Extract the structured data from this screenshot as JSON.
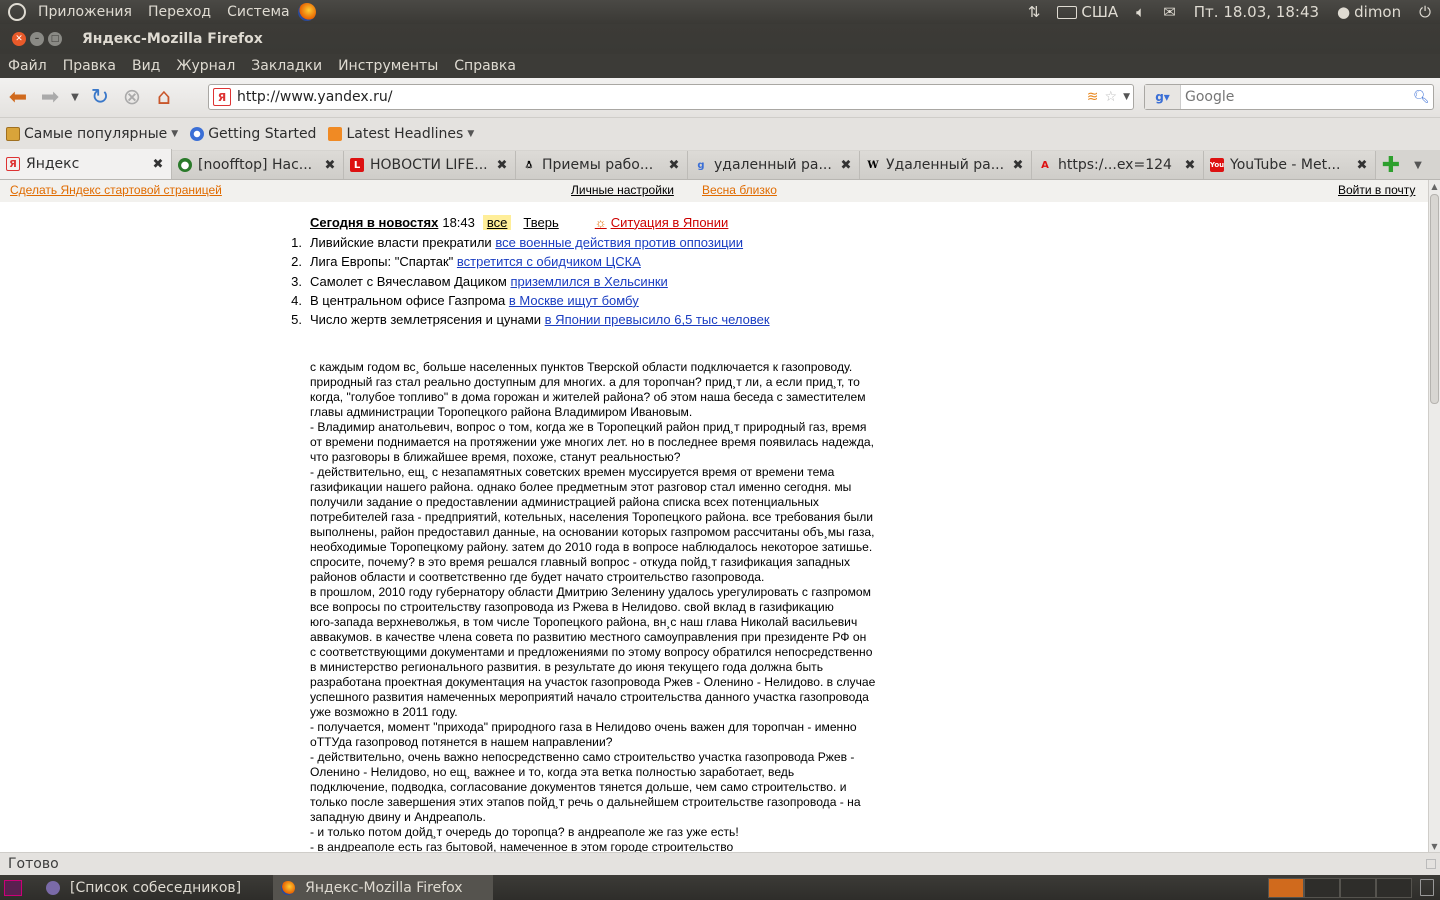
{
  "top_panel": {
    "menus": [
      "Приложения",
      "Переход",
      "Система"
    ],
    "keyboard_layout": "США",
    "datetime": "Пт. 18.03, 18:43",
    "user": "dimon"
  },
  "window": {
    "title": "Яндекс-Mozilla Firefox"
  },
  "menubar": {
    "items": [
      "Файл",
      "Правка",
      "Вид",
      "Журнал",
      "Закладки",
      "Инструменты",
      "Справка"
    ]
  },
  "navbar": {
    "url": "http://www.yandex.ru/",
    "search_placeholder": "Google"
  },
  "bookmarks": [
    {
      "label": "Самые популярные",
      "icon": "folder-icon",
      "dropdown": true
    },
    {
      "label": "Getting Started",
      "icon": "firefox-icon",
      "dropdown": false
    },
    {
      "label": "Latest Headlines",
      "icon": "rss-icon",
      "dropdown": true
    }
  ],
  "tabs": [
    {
      "label": "Яндекс",
      "icon": "yandex-icon",
      "active": true
    },
    {
      "label": "[noofftop] Нас...",
      "icon": "noofftop-icon",
      "active": false
    },
    {
      "label": "НОВОСТИ LIFE...",
      "icon": "life-icon",
      "active": false
    },
    {
      "label": "Приемы рабо...",
      "icon": "tux-icon",
      "active": false
    },
    {
      "label": "удаленный ра...",
      "icon": "google-icon",
      "active": false
    },
    {
      "label": "Удаленный ра...",
      "icon": "wikipedia-icon",
      "active": false
    },
    {
      "label": "https:/...ex=124",
      "icon": "acrobat-icon",
      "active": false
    },
    {
      "label": "YouTube - Met...",
      "icon": "youtube-icon",
      "active": false
    }
  ],
  "yandex_bar": {
    "make_start": "Сделать Яндекс стартовой страницей",
    "personal_settings": "Личные настройки",
    "spring": "Весна близко",
    "login_mail": "Войти в почту"
  },
  "news": {
    "heading": "Сегодня в новостях",
    "time": "18:43",
    "tab_all": "все",
    "tab_city": "Тверь",
    "special": "Ситуация в Японии",
    "items": [
      {
        "num": "1.",
        "text": "Ливийские власти прекратили ",
        "link": "все военные действия против оппозиции"
      },
      {
        "num": "2.",
        "text": "Лига Европы: \"Спартак\" ",
        "link": "встретится с обидчиком ЦСКА"
      },
      {
        "num": "3.",
        "text": "Самолет с Вячеславом Дациком ",
        "link": "приземлился в Хельсинки"
      },
      {
        "num": "4.",
        "text": "В центральном офисе Газпрома ",
        "link": "в Москве ищут бомбу"
      },
      {
        "num": "5.",
        "text": "Число жертв землетрясения и цунами ",
        "link": "в Японии превысило 6,5 тыс человек"
      }
    ]
  },
  "article": [
    "с каждым годом вс¸ больше населенных пунктов Тверской области подключается к газопроводу.",
    "природный газ стал реально доступным для многих. а для торопчан? прид¸т ли, а если прид¸т, то",
    "когда, \"голубое топливо\" в дома горожан и жителей района? об этом наша беседа с заместителем",
    "главы администрации Торопецкого района Владимиром Ивановым.",
    "- Владимир анатольевич, вопрос о том, когда же в Торопецкий район прид¸т природный газ, время",
    "от времени поднимается на протяжении уже многих лет. но в последнее время появилась надежда,",
    "что разговоры в ближайшее время, похоже, станут реальностью?",
    "- действительно, ещ¸ с незапамятных советских времен муссируется время от времени тема",
    "газификации нашего района. однако более предметным этот разговор стал именно сегодня. мы",
    "получили задание о предоставлении администрацией района списка всех потенциальных",
    "потребителей газа - предприятий, котельных, населения Торопецкого района. все требования были",
    "выполнены, район предоставил данные, на основании которых газпромом рассчитаны объ¸мы газа,",
    "необходимые Торопецкому району. затем до 2010 года в вопросе наблюдалось некоторое затишье.",
    "спросите, почему? в это время решался главный вопрос - откуда пойд¸т газификация западных",
    "районов области и соответственно где будет начато строительство газопровода.",
    "в прошлом, 2010 году губернатору области Дмитрию Зеленину удалось урегулировать с газпромом",
    "все вопросы по строительству газопровода из Ржева в Нелидово. свой вклад в газификацию",
    "юго-запада верхневолжья, в том числе Торопецкого района, вн¸с наш глава Николай васильевич",
    "аввакумов. в качестве члена совета по развитию местного самоуправления при президенте РФ он",
    "с соответствующими документами и предложениями по этому вопросу обратился непосредственно",
    "в министерство регионального развития. в результате до июня текущего года должна быть",
    "разработана проектная документация на участок газопровода Ржев - Оленино - Нелидово. в случае",
    "успешного развития намеченных мероприятий начало строительства данного участка газопровода",
    "уже возможно в 2011 году.",
    "- получается, момент \"прихода\" природного газа в Нелидово очень важен для торопчан - именно",
    "оТТУда газопровод потянется в нашем направлении?",
    "- действительно, очень важно непосредственно само строительство участка газопровода Ржев -",
    "Оленино - Нелидово, но ещ¸ важнее и то, когда эта ветка полностью заработает, ведь",
    "подключение, подводка, согласование документов тянется дольше, чем само строительство. и",
    "только после завершения этих этапов пойд¸т речь о дальнейшем строительстве газопровода - на",
    "западную двину и Андреаполь.",
    "- и только потом дойд¸т очередь до торопца? в андреаполе же газ уже есть!",
    "- в андреаполе есть газ бытовой, намеченное в этом городе строительство"
  ],
  "statusbar": {
    "text": "Готово"
  },
  "taskbar": {
    "tasks": [
      {
        "label": "[Список собеседников]",
        "icon": "pidgin-icon",
        "active": false
      },
      {
        "label": "Яндекс-Mozilla Firefox",
        "icon": "firefox-icon",
        "active": true
      }
    ]
  },
  "colors": {
    "panel_bg": "#3c3b37",
    "accent_orange": "#d06a1d",
    "link_blue": "#1a3dc1",
    "yandex_orange": "#e06b00"
  }
}
